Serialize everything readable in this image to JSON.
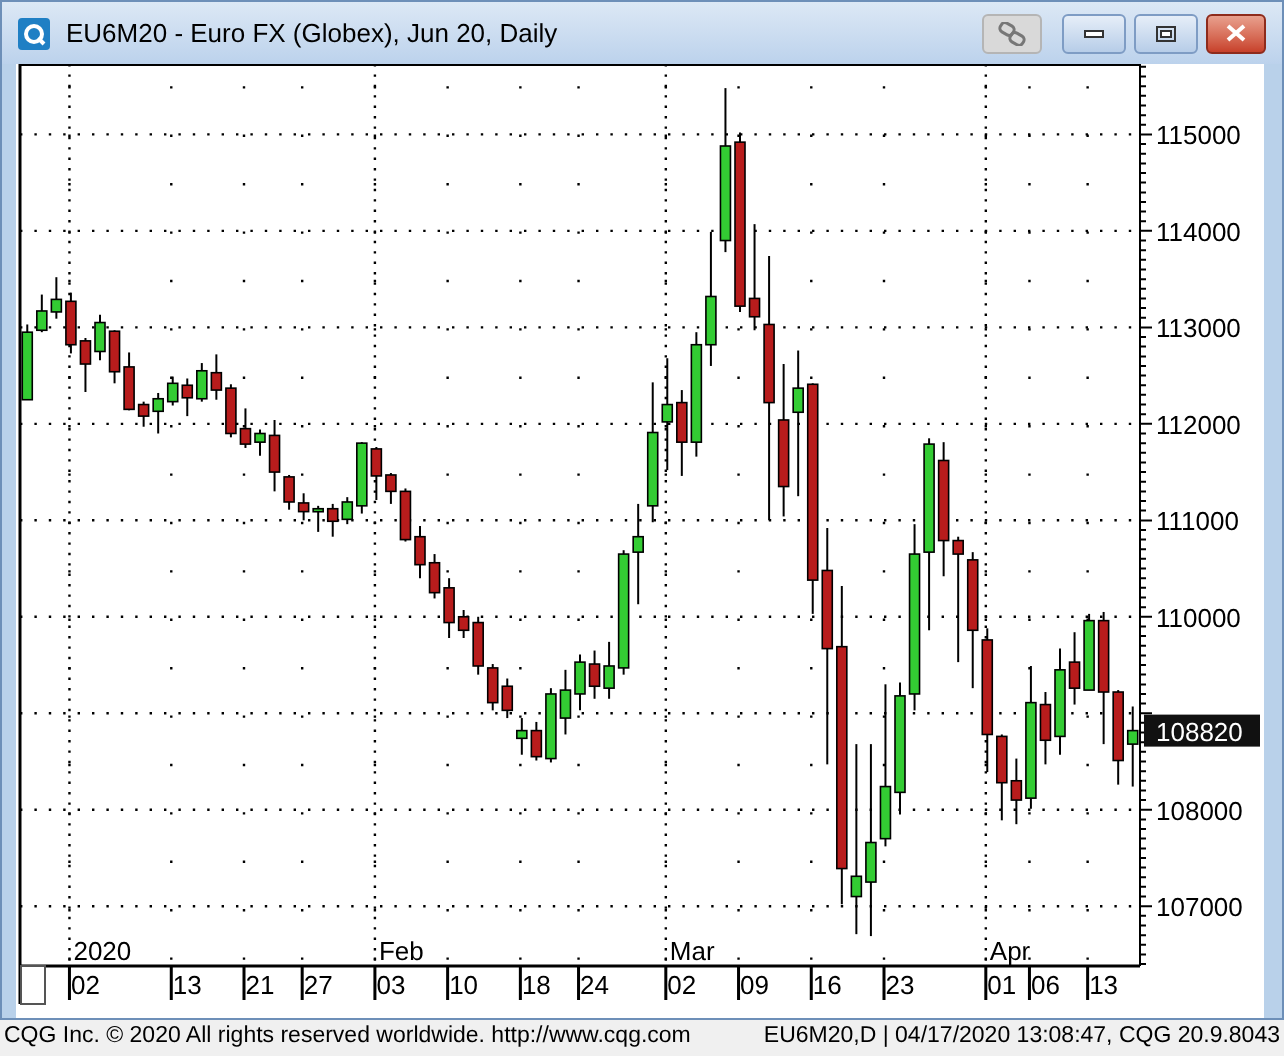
{
  "window": {
    "title": "EU6M20 - Euro FX (Globex), Jun 20, Daily"
  },
  "chart": {
    "last_price": "108820",
    "month_labels": [
      "2020",
      "Feb",
      "Mar",
      "Apr"
    ],
    "chart_data": {
      "type": "candlestick",
      "ylim": [
        106380,
        115730
      ],
      "yticks": [
        107000,
        108000,
        110000,
        111000,
        112000,
        113000,
        114000,
        115000
      ],
      "grid": true,
      "categories": [
        null,
        null,
        null,
        null,
        "02",
        null,
        null,
        null,
        null,
        null,
        null,
        "13",
        null,
        null,
        null,
        null,
        "21",
        null,
        null,
        null,
        "27",
        null,
        null,
        null,
        null,
        "03",
        null,
        null,
        null,
        null,
        "10",
        null,
        null,
        null,
        null,
        "18",
        null,
        null,
        null,
        "24",
        null,
        null,
        null,
        null,
        null,
        "02",
        null,
        null,
        null,
        null,
        "09",
        null,
        null,
        null,
        null,
        "16",
        null,
        null,
        null,
        null,
        "23",
        null,
        null,
        null,
        null,
        null,
        null,
        "01",
        null,
        null,
        "06",
        null,
        null,
        null,
        "13",
        null,
        null
      ],
      "ohlc": [
        [
          112250,
          113030,
          112250,
          112950
        ],
        [
          112970,
          113340,
          112950,
          113170
        ],
        [
          113160,
          113520,
          113090,
          113290
        ],
        [
          113270,
          113360,
          112730,
          112820
        ],
        [
          112860,
          112890,
          112330,
          112620
        ],
        [
          112750,
          113130,
          112660,
          113050
        ],
        [
          112960,
          112970,
          112420,
          112540
        ],
        [
          112590,
          112740,
          112140,
          112150
        ],
        [
          112200,
          112230,
          111970,
          112080
        ],
        [
          112130,
          112320,
          111900,
          112260
        ],
        [
          112230,
          112490,
          112190,
          112420
        ],
        [
          112400,
          112470,
          112080,
          112270
        ],
        [
          112260,
          112630,
          112230,
          112550
        ],
        [
          112530,
          112720,
          112250,
          112350
        ],
        [
          112370,
          112410,
          111860,
          111900
        ],
        [
          111950,
          112160,
          111750,
          111790
        ],
        [
          111810,
          111940,
          111670,
          111900
        ],
        [
          111880,
          112040,
          111300,
          111500
        ],
        [
          111450,
          111470,
          111110,
          111190
        ],
        [
          111180,
          111280,
          111000,
          111090
        ],
        [
          111090,
          111150,
          110880,
          111120
        ],
        [
          111120,
          111170,
          110830,
          110990
        ],
        [
          111010,
          111240,
          110960,
          111190
        ],
        [
          111150,
          111810,
          111070,
          111800
        ],
        [
          111740,
          111760,
          111210,
          111460
        ],
        [
          111470,
          111490,
          111170,
          111300
        ],
        [
          111300,
          111330,
          110780,
          110800
        ],
        [
          110830,
          110940,
          110400,
          110540
        ],
        [
          110560,
          110650,
          110190,
          110250
        ],
        [
          110300,
          110400,
          109780,
          109940
        ],
        [
          110000,
          110070,
          109780,
          109860
        ],
        [
          109940,
          110000,
          109400,
          109490
        ],
        [
          109470,
          109510,
          109030,
          109110
        ],
        [
          109280,
          109360,
          108950,
          109030
        ],
        [
          108740,
          108950,
          108570,
          108820
        ],
        [
          108820,
          108910,
          108510,
          108550
        ],
        [
          108530,
          109260,
          108490,
          109200
        ],
        [
          108950,
          109450,
          108780,
          109240
        ],
        [
          109200,
          109610,
          109030,
          109530
        ],
        [
          109510,
          109650,
          109150,
          109280
        ],
        [
          109260,
          109740,
          109150,
          109490
        ],
        [
          109470,
          110690,
          109400,
          110650
        ],
        [
          110670,
          111170,
          110130,
          110830
        ],
        [
          111150,
          112430,
          110980,
          111910
        ],
        [
          112020,
          112680,
          111520,
          112200
        ],
        [
          112220,
          112350,
          111460,
          111810
        ],
        [
          111810,
          112950,
          111660,
          112820
        ],
        [
          112820,
          113990,
          112600,
          113320
        ],
        [
          113900,
          115480,
          113780,
          114880
        ],
        [
          114920,
          115020,
          113160,
          113220
        ],
        [
          113300,
          114070,
          112970,
          113110
        ],
        [
          113030,
          113740,
          111000,
          112220
        ],
        [
          112040,
          112620,
          111040,
          111350
        ],
        [
          112120,
          112760,
          111250,
          112370
        ],
        [
          112410,
          112420,
          110030,
          110380
        ],
        [
          110480,
          110920,
          108470,
          109670
        ],
        [
          109690,
          110320,
          107020,
          107390
        ],
        [
          107100,
          108680,
          106710,
          107310
        ],
        [
          107250,
          108680,
          106690,
          107660
        ],
        [
          107700,
          109300,
          107620,
          108240
        ],
        [
          108180,
          109320,
          107950,
          109180
        ],
        [
          109200,
          110960,
          109030,
          110650
        ],
        [
          110670,
          111850,
          109860,
          111790
        ],
        [
          111620,
          111810,
          110420,
          110790
        ],
        [
          110790,
          110830,
          109530,
          110650
        ],
        [
          110590,
          110670,
          109260,
          109860
        ],
        [
          109760,
          109880,
          108390,
          108780
        ],
        [
          108760,
          108780,
          107890,
          108280
        ],
        [
          108300,
          108530,
          107850,
          108100
        ],
        [
          108120,
          109490,
          108010,
          109110
        ],
        [
          109090,
          109220,
          108470,
          108720
        ],
        [
          108760,
          109670,
          108570,
          109450
        ],
        [
          109530,
          109840,
          109090,
          109260
        ],
        [
          109240,
          110030,
          109240,
          109960
        ],
        [
          109960,
          110050,
          108680,
          109220
        ],
        [
          109220,
          109240,
          108260,
          108510
        ],
        [
          108680,
          109070,
          108240,
          108820
        ]
      ]
    }
  },
  "status_bar": {
    "left": "CQG Inc. © 2020 All rights reserved worldwide. http://www.cqg.com",
    "right": "EU6M20,D | 04/17/2020 13:08:47, CQG 20.9.8043"
  }
}
